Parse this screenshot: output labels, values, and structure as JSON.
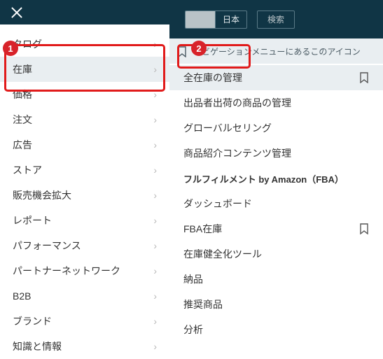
{
  "topbar": {
    "country_label": "日本",
    "search_label": "検索"
  },
  "banner": {
    "text": "ナビゲーションメニューにあるこのアイコン"
  },
  "badges": {
    "one": "1",
    "two": "2"
  },
  "menu": {
    "items": [
      {
        "label": "タログ"
      },
      {
        "label": "在庫"
      },
      {
        "label": "価格"
      },
      {
        "label": "注文"
      },
      {
        "label": "広告"
      },
      {
        "label": "ストア"
      },
      {
        "label": "販売機会拡大"
      },
      {
        "label": "レポート"
      },
      {
        "label": "パフォーマンス"
      },
      {
        "label": "パートナーネットワーク"
      },
      {
        "label": "B2B"
      },
      {
        "label": "ブランド"
      },
      {
        "label": "知識と情報"
      }
    ]
  },
  "submenu": {
    "items_a": [
      {
        "label": "全在庫の管理",
        "bookmark": true
      },
      {
        "label": "出品者出荷の商品の管理"
      },
      {
        "label": "グローバルセリング"
      },
      {
        "label": "商品紹介コンテンツ管理"
      }
    ],
    "heading": "フルフィルメント by Amazon（FBA）",
    "items_b": [
      {
        "label": "ダッシュボード"
      },
      {
        "label": "FBA在庫",
        "bookmark": true
      },
      {
        "label": "在庫健全化ツール"
      },
      {
        "label": "納品"
      },
      {
        "label": "推奨商品"
      },
      {
        "label": "分析"
      }
    ]
  }
}
